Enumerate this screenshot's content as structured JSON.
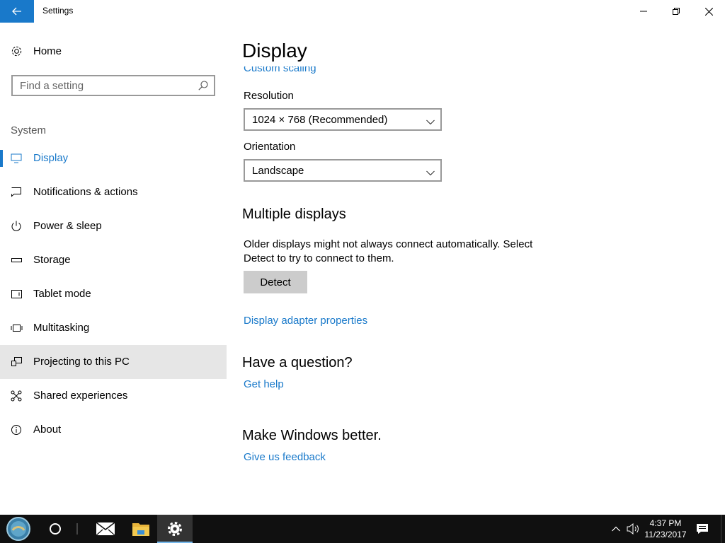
{
  "window": {
    "title": "Settings",
    "back_icon": "back-arrow-icon",
    "controls": [
      "minimize-icon",
      "maximize-icon",
      "close-icon"
    ]
  },
  "sidebar": {
    "home_label": "Home",
    "search_placeholder": "Find a setting",
    "section_label": "System",
    "items": [
      {
        "label": "Display",
        "icon": "display-icon",
        "state": "active"
      },
      {
        "label": "Notifications & actions",
        "icon": "notifications-icon"
      },
      {
        "label": "Power & sleep",
        "icon": "power-icon"
      },
      {
        "label": "Storage",
        "icon": "storage-icon"
      },
      {
        "label": "Tablet mode",
        "icon": "tablet-icon"
      },
      {
        "label": "Multitasking",
        "icon": "multitasking-icon"
      },
      {
        "label": "Projecting to this PC",
        "icon": "projecting-icon",
        "state": "hover"
      },
      {
        "label": "Shared experiences",
        "icon": "shared-icon"
      },
      {
        "label": "About",
        "icon": "info-icon"
      }
    ]
  },
  "main": {
    "title": "Display",
    "partial_link": "Custom scaling",
    "resolution": {
      "label": "Resolution",
      "value": "1024 × 768 (Recommended)"
    },
    "orientation": {
      "label": "Orientation",
      "value": "Landscape"
    },
    "multiple_displays": {
      "heading": "Multiple displays",
      "text": "Older displays might not always connect automatically. Select Detect to try to connect to them.",
      "detect_button": "Detect",
      "adapter_link": "Display adapter properties"
    },
    "question": {
      "heading": "Have a question?",
      "link": "Get help"
    },
    "better": {
      "heading": "Make Windows better.",
      "link": "Give us feedback"
    }
  },
  "taskbar": {
    "clock_time": "4:37 PM",
    "clock_date": "11/23/2017"
  },
  "colors": {
    "accent": "#1979ca",
    "taskbar": "#101010",
    "hover": "#e6e6e6"
  }
}
